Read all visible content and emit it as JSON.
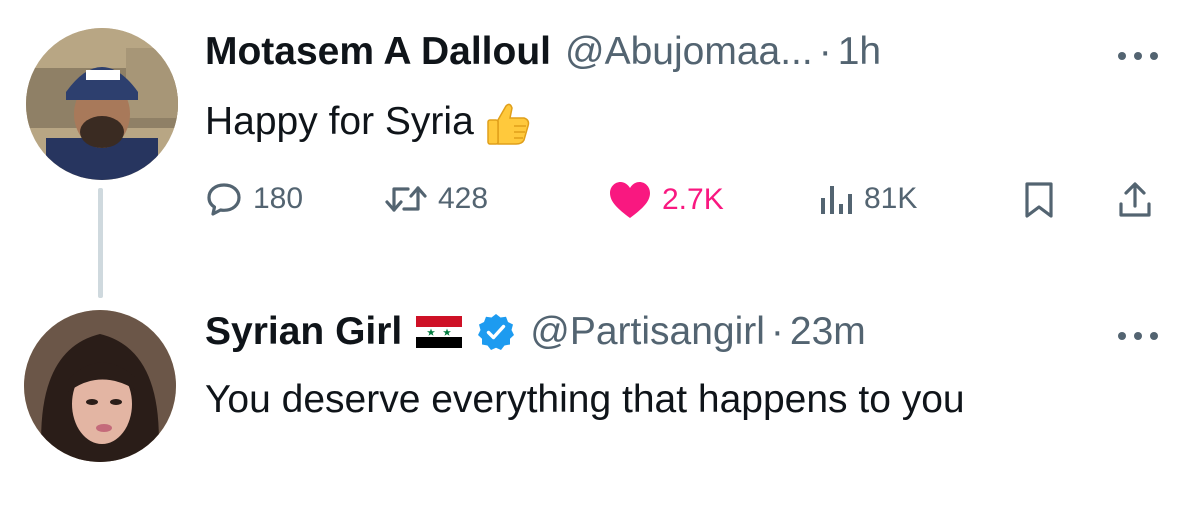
{
  "tweets": [
    {
      "display_name": "Motasem A Dalloul",
      "handle": "@Abujomaa...",
      "separator": "·",
      "time": "1h",
      "text": "Happy for Syria",
      "emoji_icon": "thumbs-up-icon",
      "metrics": {
        "replies": "180",
        "retweets": "428",
        "likes": "2.7K",
        "views": "81K"
      }
    },
    {
      "display_name": "Syrian Girl",
      "flag_icon": "syria-flag-icon",
      "verified": true,
      "handle": "@Partisangirl",
      "separator": "·",
      "time": "23m",
      "text": "You deserve everything that happens to you"
    }
  ],
  "colors": {
    "text_primary": "#0f1419",
    "text_secondary": "#536471",
    "like_pink": "#f91880",
    "verified_blue": "#1d9bf0",
    "thread_line": "#cfd9de"
  }
}
